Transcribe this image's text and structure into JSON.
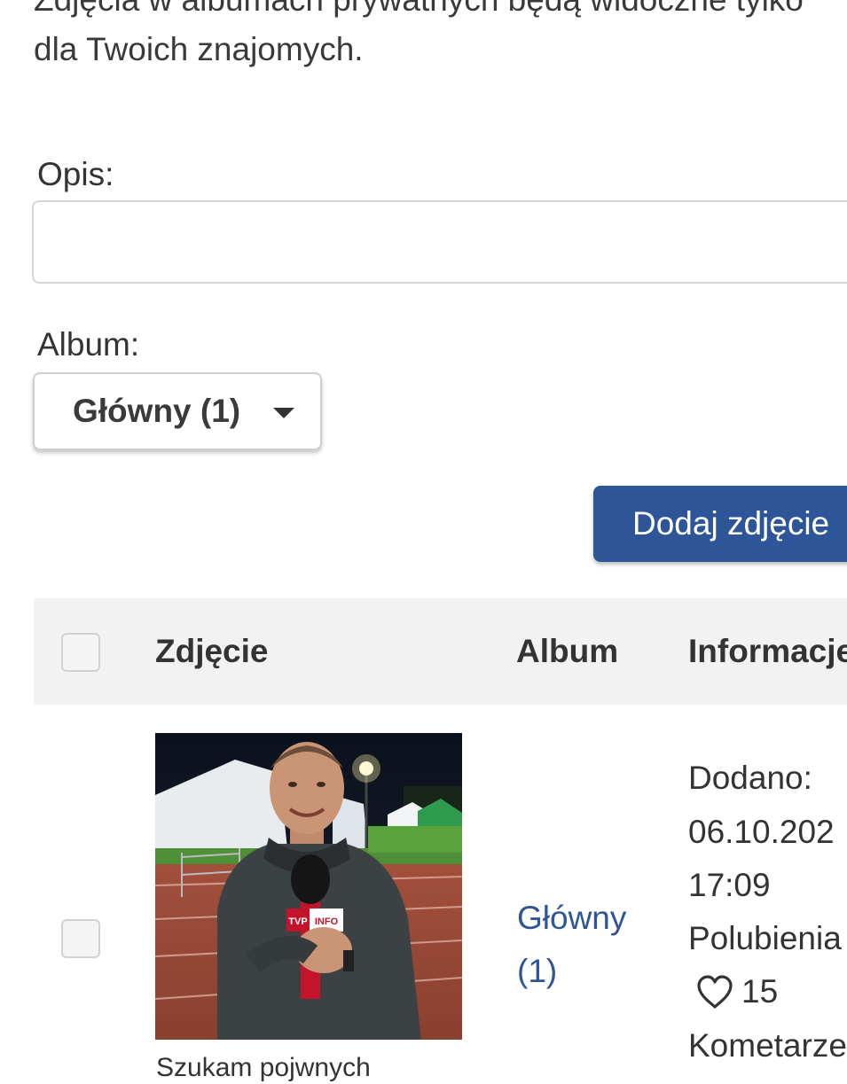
{
  "intro": {
    "line1": "Zdjęcia w albumach prywatnych będą widoczne tylko",
    "line2": "dla Twoich znajomych."
  },
  "form": {
    "description_label": "Opis:",
    "description_value": "",
    "album_label": "Album:",
    "album_selected": "Główny (1)",
    "submit_label": "Dodaj zdjęcie"
  },
  "table": {
    "headers": {
      "photo": "Zdjęcie",
      "album": "Album",
      "info": "Informacje"
    },
    "rows": [
      {
        "photo_caption": "Szukam pojwnych",
        "album_line1": "Główny",
        "album_line2": "(1)",
        "added_label": "Dodano:",
        "added_date": "06.10.202",
        "added_time": "17:09",
        "likes_label": "Polubienia",
        "likes_count": "15",
        "comments_label": "Kometarze"
      }
    ]
  },
  "photo": {
    "badge_left": "TVP",
    "badge_right": "INFO"
  },
  "colors": {
    "primary": "#2e5597",
    "header_bg": "#f2f2f2",
    "text": "#333333"
  },
  "icons": {
    "caret": "chevron-down-icon",
    "likes": "heart-icon"
  }
}
